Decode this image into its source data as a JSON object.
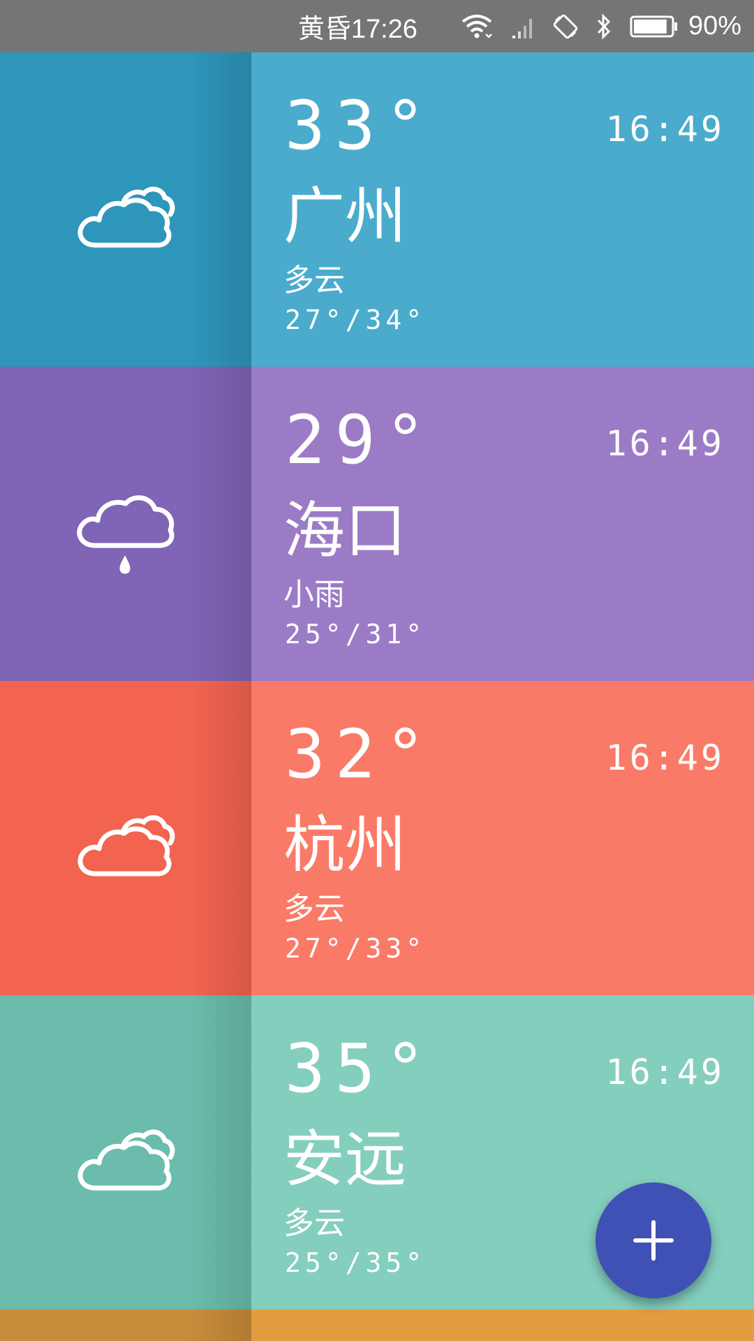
{
  "status_bar": {
    "time": "黄昏17:26",
    "battery_percent": "90%",
    "battery_level": 0.9,
    "icons": [
      "wifi-icon",
      "signal-icon",
      "rotation-lock-icon",
      "bluetooth-icon",
      "battery-icon"
    ]
  },
  "cities": [
    {
      "temp": "33°",
      "time": "16:49",
      "name": "广州",
      "condition": "多云",
      "range": "27°/34°",
      "icon": "cloudy-icon",
      "icon_bg": "#2E96BA",
      "bg": "#4AABCD"
    },
    {
      "temp": "29°",
      "time": "16:49",
      "name": "海口",
      "condition": "小雨",
      "range": "25°/31°",
      "icon": "light-rain-icon",
      "icon_bg": "#8064B5",
      "bg": "#9B7BC6"
    },
    {
      "temp": "32°",
      "time": "16:49",
      "name": "杭州",
      "condition": "多云",
      "range": "27°/33°",
      "icon": "cloudy-icon",
      "icon_bg": "#F26450",
      "bg": "#FA7A68"
    },
    {
      "temp": "35°",
      "time": "16:49",
      "name": "安远",
      "condition": "多云",
      "range": "25°/35°",
      "icon": "cloudy-icon",
      "icon_bg": "#6BBCAC",
      "bg": "#84CEBE"
    }
  ],
  "partial_card": {
    "icon_bg": "#C98C3A",
    "bg": "#E39D40"
  },
  "fab": {
    "icon": "plus-icon",
    "color": "#3F51B5"
  }
}
